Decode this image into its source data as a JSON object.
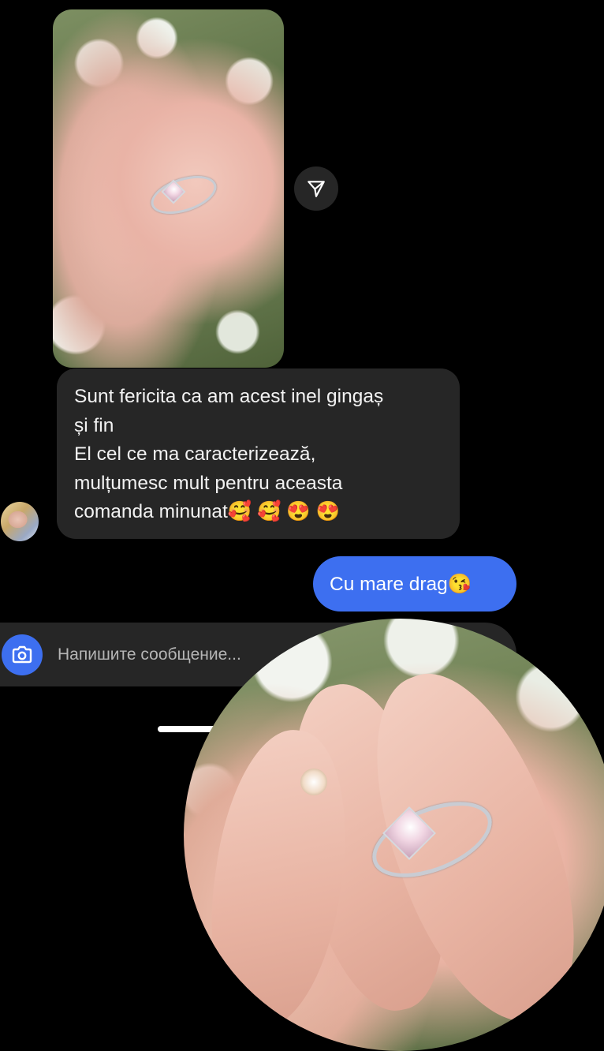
{
  "thread": {
    "incoming_photo": {
      "alt": ""
    },
    "share_icon": "paper-plane-icon",
    "incoming_message": {
      "lines": [
        "Sunt fericita ca am acest inel gingaș",
        "și fin",
        "El cel ce ma caracterizează,",
        "mulțumesc mult pentru aceasta",
        "comanda minunat🥰 🥰 😍 😍"
      ]
    },
    "sender_avatar": "avatar-photo",
    "outgoing_message": {
      "text": "Cu mare drag😘"
    }
  },
  "composer": {
    "camera_icon": "camera-icon",
    "placeholder": "Напишите сообщение..."
  },
  "colors": {
    "background": "#000000",
    "incoming_bubble": "#262626",
    "outgoing_bubble": "#3d6ff0",
    "composer": "#262626"
  }
}
